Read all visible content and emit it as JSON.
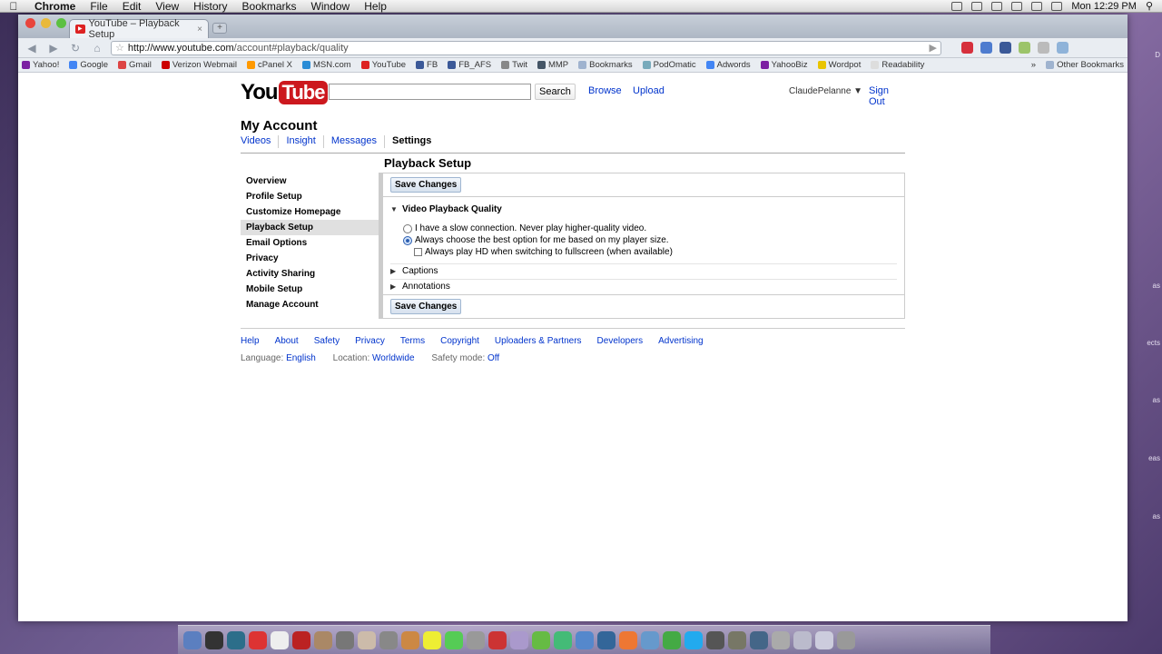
{
  "menubar": {
    "app": "Chrome",
    "items": [
      "File",
      "Edit",
      "View",
      "History",
      "Bookmarks",
      "Window",
      "Help"
    ],
    "clock": "Mon 12:29 PM"
  },
  "browser": {
    "tab_title": "YouTube – Playback Setup",
    "tab_close": "×",
    "new_tab": "+",
    "url_host": "http://www.youtube.com",
    "url_path": "/account#playback/quality",
    "bookmarks": [
      "Yahoo!",
      "Google",
      "Gmail",
      "Verizon Webmail",
      "cPanel X",
      "MSN.com",
      "YouTube",
      "FB",
      "FB_AFS",
      "Twit",
      "MMP",
      "Bookmarks",
      "PodOmatic",
      "Adwords",
      "YahooBiz",
      "Wordpot",
      "Readability"
    ],
    "bookmarks_overflow": "»",
    "other_bookmarks": "Other Bookmarks",
    "nav_icons": [
      "back-icon",
      "forward-icon",
      "reload-icon",
      "home-icon",
      "star-icon"
    ]
  },
  "header": {
    "logo_you": "You",
    "logo_tube": "Tube",
    "search_value": "",
    "search_button": "Search",
    "browse": "Browse",
    "upload": "Upload",
    "username": "ClaudePelanne",
    "signout": "Sign Out"
  },
  "account": {
    "title": "My Account",
    "tabs": [
      "Videos",
      "Insight",
      "Messages",
      "Settings"
    ],
    "section_title": "Playback Setup"
  },
  "sidebar": {
    "items": [
      "Overview",
      "Profile Setup",
      "Customize Homepage",
      "Playback Setup",
      "Email Options",
      "Privacy",
      "Activity Sharing",
      "Mobile Setup",
      "Manage Account"
    ]
  },
  "panel": {
    "save_label": "Save Changes",
    "quality_heading": "Video Playback Quality",
    "option_slow": "I have a slow connection. Never play higher-quality video.",
    "option_best": "Always choose the best option for me based on my player size.",
    "option_hd": "Always play HD when switching to fullscreen (when available)",
    "captions": "Captions",
    "annotations": "Annotations"
  },
  "footer": {
    "links": [
      "Help",
      "About",
      "Safety",
      "Privacy",
      "Terms",
      "Copyright",
      "Uploaders & Partners",
      "Developers",
      "Advertising"
    ],
    "language_label": "Language:",
    "language_value": "English",
    "location_label": "Location:",
    "location_value": "Worldwide",
    "safety_label": "Safety mode:",
    "safety_value": "Off"
  },
  "desktop_side": [
    "D",
    "as",
    "ects",
    "as",
    "eas",
    "as"
  ]
}
